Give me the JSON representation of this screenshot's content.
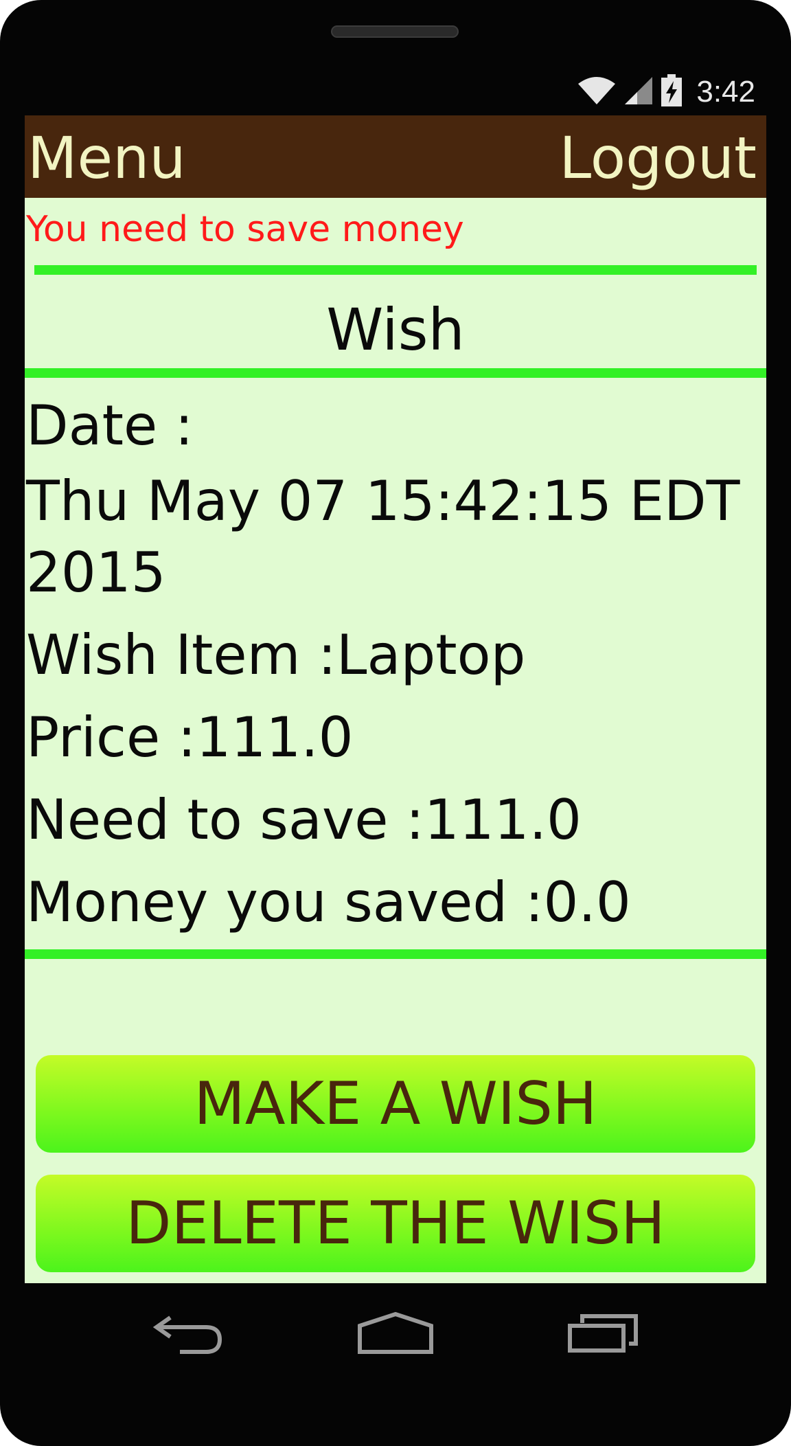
{
  "status_bar": {
    "time": "3:42",
    "icons": [
      "wifi-icon",
      "signal-icon",
      "battery-charging-icon"
    ]
  },
  "topbar": {
    "menu_label": "Menu",
    "logout_label": "Logout"
  },
  "alert": {
    "text": "You need to save money"
  },
  "section": {
    "title": "Wish"
  },
  "wish": {
    "date_label": "Date :",
    "date_value_line1": "Thu May 07 15:42:15 EDT",
    "date_value_line2": "2015",
    "item_line": "Wish Item :Laptop",
    "price_line": "Price :111.0",
    "need_line": "Need to save :111.0",
    "saved_line": "Money you saved :0.0"
  },
  "actions": {
    "make_label": "MAKE A WISH",
    "delete_label": "DELETE THE WISH"
  },
  "navbar": {
    "icons": [
      "back-icon",
      "home-icon",
      "recents-icon"
    ]
  },
  "colors": {
    "topbar_bg": "#48260d",
    "screen_bg": "#e1fbd2",
    "divider": "#33f026",
    "alert_text": "#ff1a1a",
    "button_text": "#48260d"
  }
}
